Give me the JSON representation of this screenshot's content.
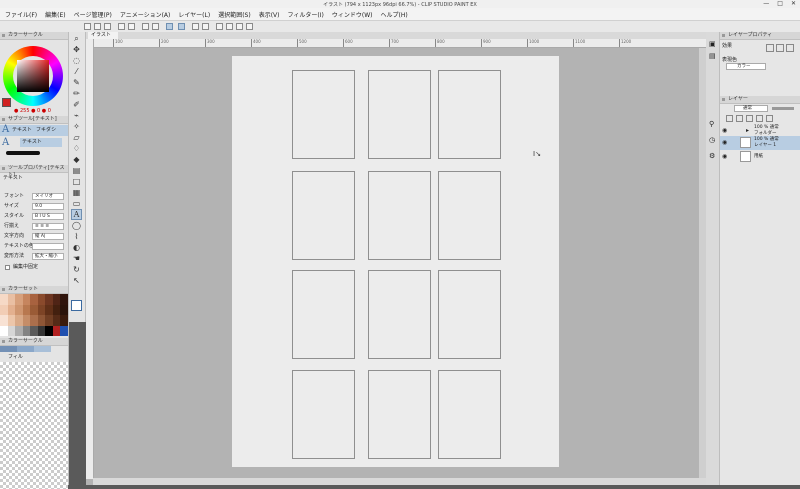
{
  "window": {
    "title": "イラスト (794 x 1123px 96dpi 66.7%) - CLIP STUDIO PAINT EX",
    "controls": [
      "—",
      "□",
      "✕"
    ]
  },
  "menu": [
    "ファイル(F)",
    "編集(E)",
    "ページ管理(P)",
    "アニメーション(A)",
    "レイヤー(L)",
    "選択範囲(S)",
    "表示(V)",
    "フィルター(I)",
    "ウィンドウ(W)",
    "ヘルプ(H)"
  ],
  "left": {
    "color_panel_title": "カラーサークル",
    "rgb_readout": "● 255 ● 0 ● 0",
    "subtool_panel_title": "サブツール[テキスト]",
    "subtools": [
      {
        "label": "テキスト"
      },
      {
        "label": "フキダシ"
      }
    ],
    "subtool_sel": "テキスト",
    "tool_property_title": "ツールプロパティ[テキスト]",
    "tool_property_name": "テキスト",
    "props": [
      {
        "label": "フォント",
        "value": "メイリオ"
      },
      {
        "label": "サイズ",
        "value": "9.0"
      },
      {
        "label": "スタイル",
        "value": "B I U S"
      },
      {
        "label": "行揃え",
        "value": "≡ ≡ ≡"
      },
      {
        "label": "文字方向",
        "value": "縦 A|"
      },
      {
        "label": "テキストの色",
        "value": ""
      },
      {
        "label": "変形方法",
        "value": "拡大・縮小"
      }
    ],
    "checkbox_label": "編集中固定",
    "palette_title": "カラーセット",
    "history_title": "カラーサークル",
    "fill_label": "フィル"
  },
  "canvas": {
    "tab_label": "イラスト",
    "ruler_ticks": [
      "100",
      "200",
      "300",
      "400",
      "500",
      "600",
      "700",
      "800",
      "900",
      "1000",
      "1100",
      "1200"
    ]
  },
  "right": {
    "layer_property_title": "レイヤープロパティ",
    "effect_label": "効果",
    "expression_label": "表現色",
    "expression_value": "カラー",
    "layer_panel_title": "レイヤー",
    "blend_mode": "通常",
    "layers": [
      {
        "name": "100 % 通常",
        "sub": "フォルダー"
      },
      {
        "name": "100 % 通常",
        "sub": "レイヤー 1"
      },
      {
        "name": "用紙",
        "sub": ""
      }
    ]
  },
  "colors": {
    "accent": "#b8cde2",
    "canvas_bg": "#b3b3b3",
    "paper": "#ececec"
  }
}
